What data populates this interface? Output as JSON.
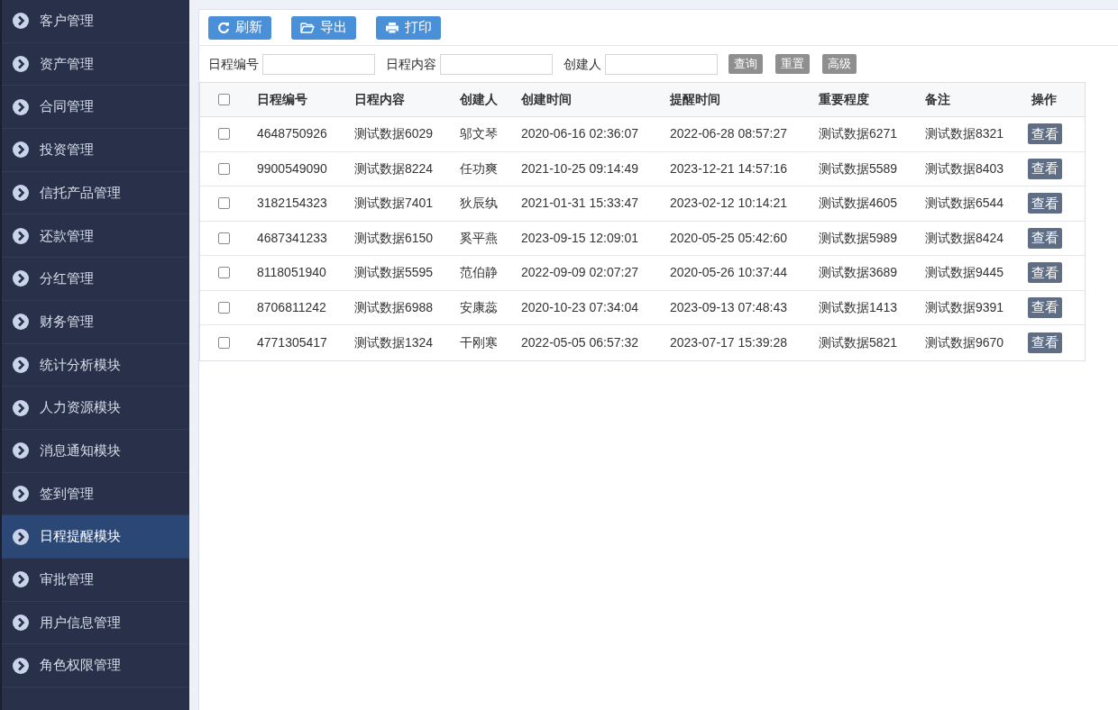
{
  "sidebar": {
    "items": [
      {
        "label": "客户管理",
        "selected": false
      },
      {
        "label": "资产管理",
        "selected": false
      },
      {
        "label": "合同管理",
        "selected": false
      },
      {
        "label": "投资管理",
        "selected": false
      },
      {
        "label": "信托产品管理",
        "selected": false
      },
      {
        "label": "还款管理",
        "selected": false
      },
      {
        "label": "分红管理",
        "selected": false
      },
      {
        "label": "财务管理",
        "selected": false
      },
      {
        "label": "统计分析模块",
        "selected": false
      },
      {
        "label": "人力资源模块",
        "selected": false
      },
      {
        "label": "消息通知模块",
        "selected": false
      },
      {
        "label": "签到管理",
        "selected": false
      },
      {
        "label": "日程提醒模块",
        "selected": true
      },
      {
        "label": "审批管理",
        "selected": false
      },
      {
        "label": "用户信息管理",
        "selected": false
      },
      {
        "label": "角色权限管理",
        "selected": false
      }
    ]
  },
  "toolbar": [
    {
      "kind": "refresh",
      "label": "刷新"
    },
    {
      "kind": "export",
      "label": "导出"
    },
    {
      "kind": "print",
      "label": "打印"
    }
  ],
  "filters": {
    "fields": [
      {
        "label": "日程编号"
      },
      {
        "label": "日程内容"
      },
      {
        "label": "创建人"
      }
    ],
    "buttons": [
      "查询",
      "重置",
      "高级"
    ]
  },
  "table": {
    "select_all_checked": false,
    "columns": [
      "日程编号",
      "日程内容",
      "创建人",
      "创建时间",
      "提醒时间",
      "重要程度",
      "备注",
      "操作"
    ],
    "rows": [
      {
        "checked": false,
        "cells": [
          "4648750926",
          "测试数据6029",
          "邬文琴",
          "2020-06-16 02:36:07",
          "2022-06-28 08:57:27",
          "测试数据6271",
          "测试数据8321"
        ],
        "action": "查看"
      },
      {
        "checked": false,
        "cells": [
          "9900549090",
          "测试数据8224",
          "任功爽",
          "2021-10-25 09:14:49",
          "2023-12-21 14:57:16",
          "测试数据5589",
          "测试数据8403"
        ],
        "action": "查看"
      },
      {
        "checked": false,
        "cells": [
          "3182154323",
          "测试数据7401",
          "狄辰纨",
          "2021-01-31 15:33:47",
          "2023-02-12 10:14:21",
          "测试数据4605",
          "测试数据6544"
        ],
        "action": "查看"
      },
      {
        "checked": false,
        "cells": [
          "4687341233",
          "测试数据6150",
          "奚平燕",
          "2023-09-15 12:09:01",
          "2020-05-25 05:42:60",
          "测试数据5989",
          "测试数据8424"
        ],
        "action": "查看"
      },
      {
        "checked": false,
        "cells": [
          "8118051940",
          "测试数据5595",
          "范伯静",
          "2022-09-09 02:07:27",
          "2020-05-26 10:37:44",
          "测试数据3689",
          "测试数据9445"
        ],
        "action": "查看"
      },
      {
        "checked": false,
        "cells": [
          "8706811242",
          "测试数据6988",
          "安康蕊",
          "2020-10-23 07:34:04",
          "2023-09-13 07:48:43",
          "测试数据1413",
          "测试数据9391"
        ],
        "action": "查看"
      },
      {
        "checked": false,
        "cells": [
          "4771305417",
          "测试数据1324",
          "干刚寒",
          "2022-05-05 06:57:32",
          "2023-07-17 15:39:28",
          "测试数据5821",
          "测试数据9670"
        ],
        "action": "查看"
      }
    ]
  }
}
